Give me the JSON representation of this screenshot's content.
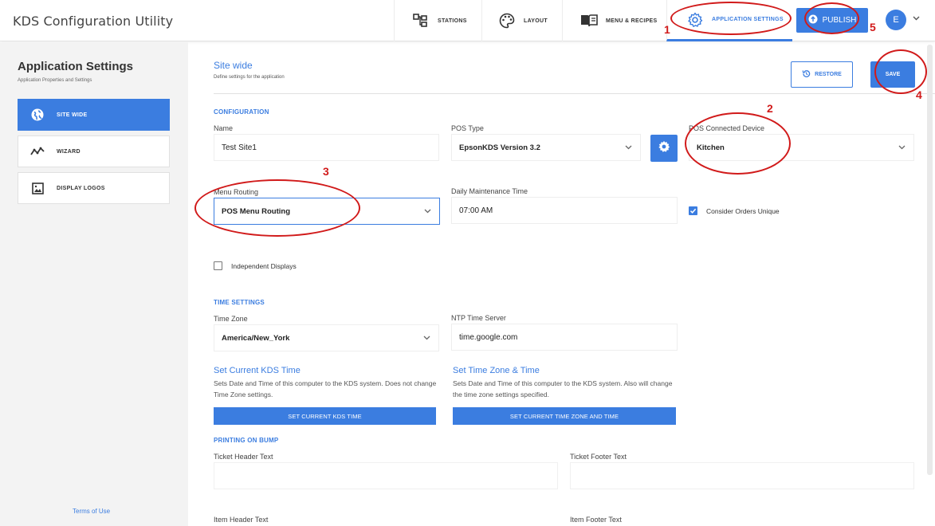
{
  "app": {
    "title": "KDS Configuration Utility"
  },
  "nav": {
    "tabs": [
      {
        "label": "STATIONS",
        "icon": "stations-icon"
      },
      {
        "label": "LAYOUT",
        "icon": "palette-icon"
      },
      {
        "label": "MENU & RECIPES",
        "icon": "book-icon"
      },
      {
        "label": "APPLICATION SETTINGS",
        "icon": "gear-icon"
      }
    ],
    "publish_label": "PUBLISH",
    "avatar_initial": "E"
  },
  "sidebar": {
    "title": "Application Settings",
    "subtitle": "Application Properties and Settings",
    "items": [
      {
        "label": "SITE WIDE",
        "icon": "globe-icon"
      },
      {
        "label": "WIZARD",
        "icon": "wizard-icon"
      },
      {
        "label": "DISPLAY LOGOS",
        "icon": "image-icon"
      }
    ],
    "terms_label": "Terms of Use"
  },
  "page": {
    "title": "Site wide",
    "subtitle": "Define settings for the application",
    "restore_label": "RESTORE",
    "save_label": "SAVE"
  },
  "configuration": {
    "heading": "CONFIGURATION",
    "name_label": "Name",
    "name_value": "Test Site1",
    "pos_type_label": "POS Type",
    "pos_type_value": "EpsonKDS Version 3.2",
    "pos_device_label": "POS Connected Device",
    "pos_device_value": "Kitchen",
    "menu_routing_label": "Menu Routing",
    "menu_routing_value": "POS Menu Routing",
    "maintenance_label": "Daily Maintenance Time",
    "maintenance_value": "07:00 AM",
    "unique_orders_label": "Consider Orders Unique",
    "independent_displays_label": "Independent Displays"
  },
  "time_settings": {
    "heading": "TIME SETTINGS",
    "timezone_label": "Time Zone",
    "timezone_value": "America/New_York",
    "ntp_label": "NTP Time Server",
    "ntp_value": "time.google.com",
    "set_kds_title": "Set Current KDS Time",
    "set_kds_desc": "Sets Date and Time of this computer to the KDS system. Does not change Time Zone settings.",
    "set_kds_button": "SET CURRENT KDS TIME",
    "set_tz_title": "Set Time Zone & Time",
    "set_tz_desc": "Sets Date and Time of this computer to the KDS system. Also will change the time zone settings specified.",
    "set_tz_button": "SET CURRENT TIME ZONE AND TIME"
  },
  "printing": {
    "heading": "PRINTING ON BUMP",
    "ticket_header_label": "Ticket Header Text",
    "ticket_footer_label": "Ticket Footer Text",
    "item_header_label": "Item Header Text",
    "item_footer_label": "Item Footer Text"
  },
  "annotations": [
    "1",
    "2",
    "3",
    "4",
    "5"
  ],
  "colors": {
    "accent": "#3b7de0",
    "annotation": "#d11a1a",
    "sidebar_bg": "#f3f3f3"
  }
}
